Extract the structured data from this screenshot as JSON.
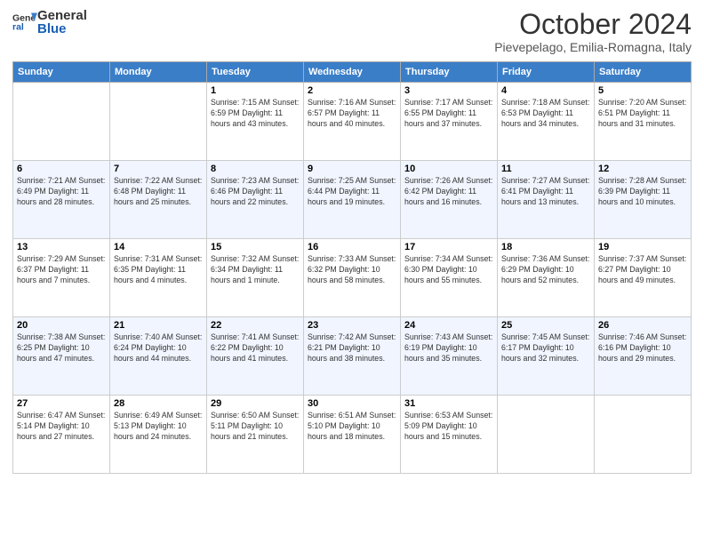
{
  "logo": {
    "line1": "General",
    "line2": "Blue"
  },
  "title": "October 2024",
  "location": "Pievepelago, Emilia-Romagna, Italy",
  "days_of_week": [
    "Sunday",
    "Monday",
    "Tuesday",
    "Wednesday",
    "Thursday",
    "Friday",
    "Saturday"
  ],
  "weeks": [
    [
      {
        "day": "",
        "info": ""
      },
      {
        "day": "",
        "info": ""
      },
      {
        "day": "1",
        "info": "Sunrise: 7:15 AM\nSunset: 6:59 PM\nDaylight: 11 hours and 43 minutes."
      },
      {
        "day": "2",
        "info": "Sunrise: 7:16 AM\nSunset: 6:57 PM\nDaylight: 11 hours and 40 minutes."
      },
      {
        "day": "3",
        "info": "Sunrise: 7:17 AM\nSunset: 6:55 PM\nDaylight: 11 hours and 37 minutes."
      },
      {
        "day": "4",
        "info": "Sunrise: 7:18 AM\nSunset: 6:53 PM\nDaylight: 11 hours and 34 minutes."
      },
      {
        "day": "5",
        "info": "Sunrise: 7:20 AM\nSunset: 6:51 PM\nDaylight: 11 hours and 31 minutes."
      }
    ],
    [
      {
        "day": "6",
        "info": "Sunrise: 7:21 AM\nSunset: 6:49 PM\nDaylight: 11 hours and 28 minutes."
      },
      {
        "day": "7",
        "info": "Sunrise: 7:22 AM\nSunset: 6:48 PM\nDaylight: 11 hours and 25 minutes."
      },
      {
        "day": "8",
        "info": "Sunrise: 7:23 AM\nSunset: 6:46 PM\nDaylight: 11 hours and 22 minutes."
      },
      {
        "day": "9",
        "info": "Sunrise: 7:25 AM\nSunset: 6:44 PM\nDaylight: 11 hours and 19 minutes."
      },
      {
        "day": "10",
        "info": "Sunrise: 7:26 AM\nSunset: 6:42 PM\nDaylight: 11 hours and 16 minutes."
      },
      {
        "day": "11",
        "info": "Sunrise: 7:27 AM\nSunset: 6:41 PM\nDaylight: 11 hours and 13 minutes."
      },
      {
        "day": "12",
        "info": "Sunrise: 7:28 AM\nSunset: 6:39 PM\nDaylight: 11 hours and 10 minutes."
      }
    ],
    [
      {
        "day": "13",
        "info": "Sunrise: 7:29 AM\nSunset: 6:37 PM\nDaylight: 11 hours and 7 minutes."
      },
      {
        "day": "14",
        "info": "Sunrise: 7:31 AM\nSunset: 6:35 PM\nDaylight: 11 hours and 4 minutes."
      },
      {
        "day": "15",
        "info": "Sunrise: 7:32 AM\nSunset: 6:34 PM\nDaylight: 11 hours and 1 minute."
      },
      {
        "day": "16",
        "info": "Sunrise: 7:33 AM\nSunset: 6:32 PM\nDaylight: 10 hours and 58 minutes."
      },
      {
        "day": "17",
        "info": "Sunrise: 7:34 AM\nSunset: 6:30 PM\nDaylight: 10 hours and 55 minutes."
      },
      {
        "day": "18",
        "info": "Sunrise: 7:36 AM\nSunset: 6:29 PM\nDaylight: 10 hours and 52 minutes."
      },
      {
        "day": "19",
        "info": "Sunrise: 7:37 AM\nSunset: 6:27 PM\nDaylight: 10 hours and 49 minutes."
      }
    ],
    [
      {
        "day": "20",
        "info": "Sunrise: 7:38 AM\nSunset: 6:25 PM\nDaylight: 10 hours and 47 minutes."
      },
      {
        "day": "21",
        "info": "Sunrise: 7:40 AM\nSunset: 6:24 PM\nDaylight: 10 hours and 44 minutes."
      },
      {
        "day": "22",
        "info": "Sunrise: 7:41 AM\nSunset: 6:22 PM\nDaylight: 10 hours and 41 minutes."
      },
      {
        "day": "23",
        "info": "Sunrise: 7:42 AM\nSunset: 6:21 PM\nDaylight: 10 hours and 38 minutes."
      },
      {
        "day": "24",
        "info": "Sunrise: 7:43 AM\nSunset: 6:19 PM\nDaylight: 10 hours and 35 minutes."
      },
      {
        "day": "25",
        "info": "Sunrise: 7:45 AM\nSunset: 6:17 PM\nDaylight: 10 hours and 32 minutes."
      },
      {
        "day": "26",
        "info": "Sunrise: 7:46 AM\nSunset: 6:16 PM\nDaylight: 10 hours and 29 minutes."
      }
    ],
    [
      {
        "day": "27",
        "info": "Sunrise: 6:47 AM\nSunset: 5:14 PM\nDaylight: 10 hours and 27 minutes."
      },
      {
        "day": "28",
        "info": "Sunrise: 6:49 AM\nSunset: 5:13 PM\nDaylight: 10 hours and 24 minutes."
      },
      {
        "day": "29",
        "info": "Sunrise: 6:50 AM\nSunset: 5:11 PM\nDaylight: 10 hours and 21 minutes."
      },
      {
        "day": "30",
        "info": "Sunrise: 6:51 AM\nSunset: 5:10 PM\nDaylight: 10 hours and 18 minutes."
      },
      {
        "day": "31",
        "info": "Sunrise: 6:53 AM\nSunset: 5:09 PM\nDaylight: 10 hours and 15 minutes."
      },
      {
        "day": "",
        "info": ""
      },
      {
        "day": "",
        "info": ""
      }
    ]
  ]
}
